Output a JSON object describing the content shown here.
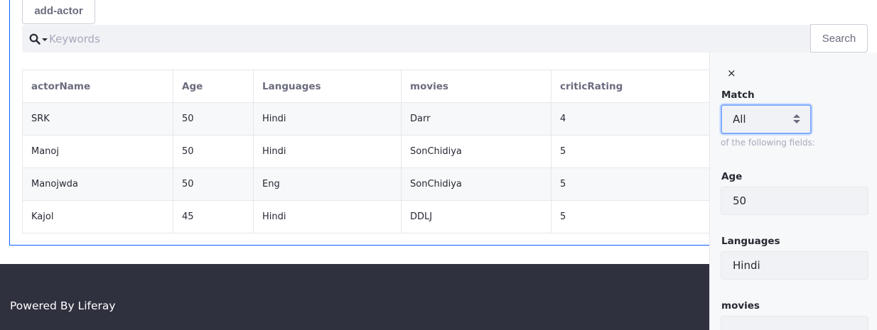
{
  "toolbar": {
    "add_label": "add-actor"
  },
  "search": {
    "placeholder": "Keywords",
    "value": "",
    "button_label": "Search"
  },
  "table": {
    "headers": [
      "actorName",
      "Age",
      "Languages",
      "movies",
      "criticRating"
    ],
    "rows": [
      [
        "SRK",
        "50",
        "Hindi",
        "Darr",
        "4"
      ],
      [
        "Manoj",
        "50",
        "Hindi",
        "SonChidiya",
        "5"
      ],
      [
        "Manojwda",
        "50",
        "Eng",
        "SonChidiya",
        "5"
      ],
      [
        "Kajol",
        "45",
        "Hindi",
        "DDLJ",
        "5"
      ]
    ]
  },
  "footer": {
    "text": "Powered By Liferay"
  },
  "filter_panel": {
    "close_glyph": "×",
    "match_label": "Match",
    "match_value": "All",
    "match_helper": "of the following fields:",
    "fields": [
      {
        "label": "Age",
        "value": "50"
      },
      {
        "label": "Languages",
        "value": "Hindi"
      },
      {
        "label": "movies",
        "value": ""
      }
    ]
  },
  "icons": {
    "search": "search-icon",
    "caret": "caret-down-icon",
    "close": "close-icon",
    "select": "select-arrows-icon"
  },
  "colors": {
    "accent": "#0b5fff",
    "footer_bg": "#30313f",
    "focus_ring": "#80acff"
  }
}
